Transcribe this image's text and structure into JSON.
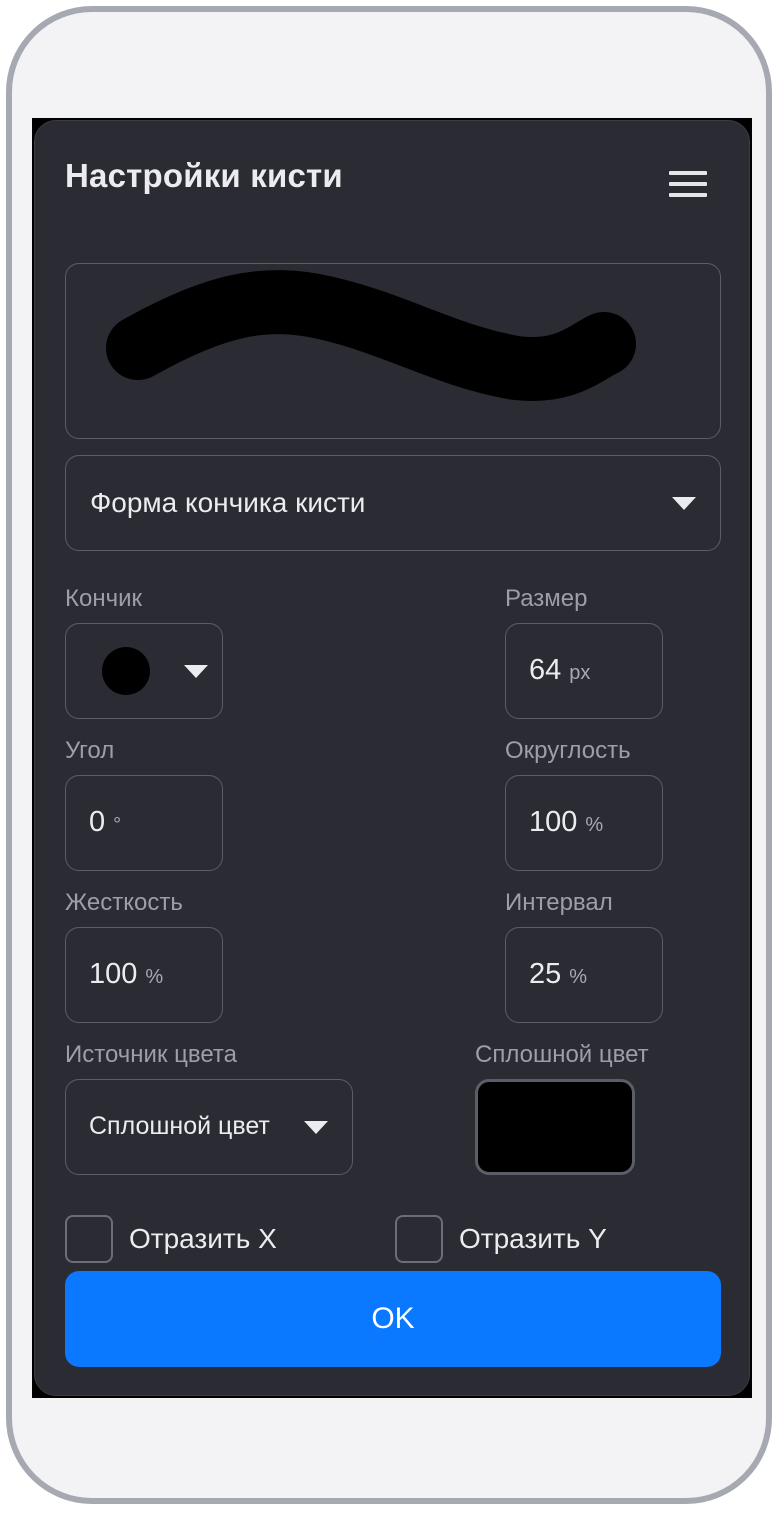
{
  "dialog": {
    "title": "Настройки кисти",
    "menu_icon": "hamburger-menu-icon"
  },
  "preview": {
    "stroke_color": "#000000"
  },
  "tip_shape_dropdown": {
    "value": "Форма кончика кисти"
  },
  "fields": {
    "tip": {
      "label": "Кончик",
      "icon": "round-tip-icon"
    },
    "size": {
      "label": "Размер",
      "value": "64",
      "unit": "px"
    },
    "angle": {
      "label": "Угол",
      "value": "0",
      "unit": "°"
    },
    "roundness": {
      "label": "Округлость",
      "value": "100",
      "unit": "%"
    },
    "hardness": {
      "label": "Жесткость",
      "value": "100",
      "unit": "%"
    },
    "spacing": {
      "label": "Интервал",
      "value": "25",
      "unit": "%"
    },
    "color_source": {
      "label": "Источник цвета",
      "value": "Сплошной цвет"
    },
    "solid_color": {
      "label": "Сплошной цвет",
      "color": "#000000"
    }
  },
  "checkboxes": {
    "flip_x": {
      "label": "Отразить X",
      "checked": false
    },
    "flip_y": {
      "label": "Отразить Y",
      "checked": false
    }
  },
  "ok_button": {
    "label": "OK"
  },
  "colors": {
    "panel": "#2a2b33",
    "accent": "#0a78ff",
    "text": "#ececf0",
    "muted_text": "#9c9ea8",
    "border": "#5b5d68"
  }
}
